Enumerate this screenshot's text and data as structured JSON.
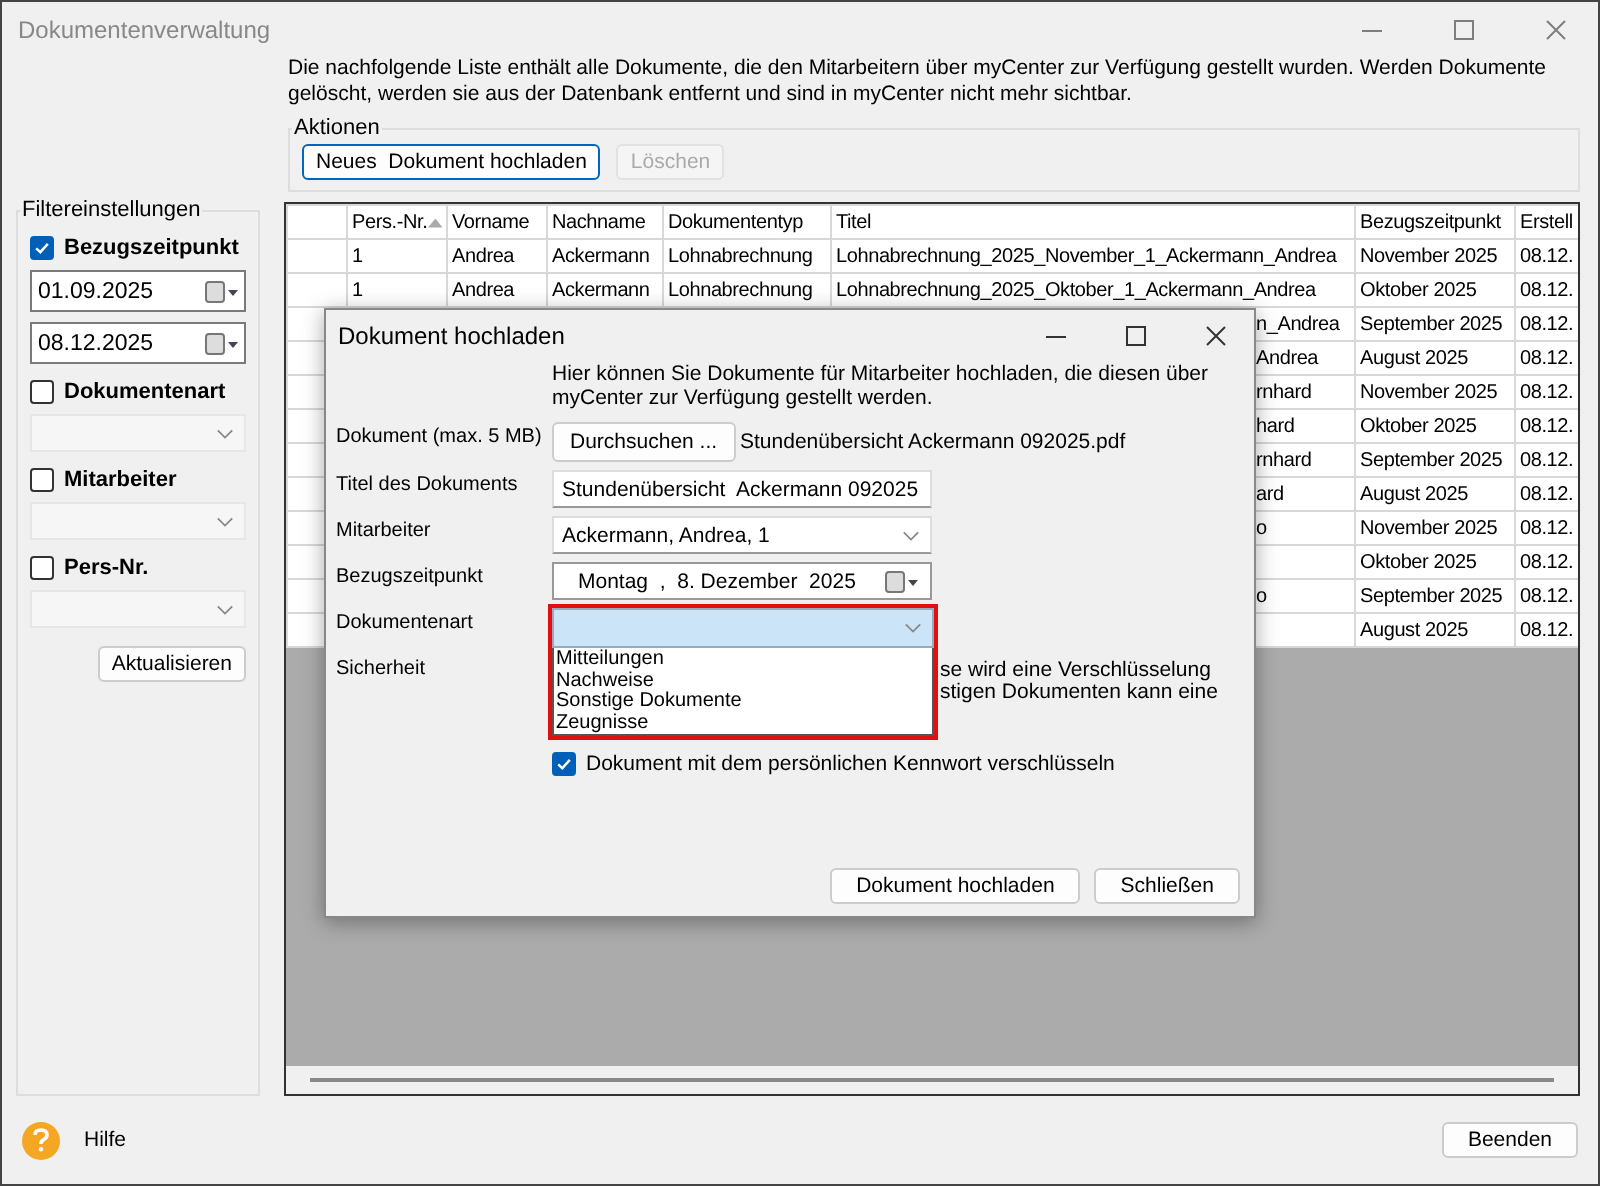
{
  "window": {
    "title": "Dokumentenverwaltung"
  },
  "description": "Die nachfolgende Liste enthält alle Dokumente, die den Mitarbeitern über myCenter zur Verfügung gestellt wurden. Werden Dokumente gelöscht, werden sie aus der Datenbank entfernt und sind in myCenter nicht mehr sichtbar.",
  "actions": {
    "title": "Aktionen",
    "buttons": [
      {
        "label": "Neues  Dokument hochladen",
        "disabled": false,
        "focused": true
      },
      {
        "label": "Löschen",
        "disabled": true,
        "focused": false
      }
    ]
  },
  "filters": {
    "title": "Filtereinstellungen",
    "items": [
      {
        "kind": "dates",
        "label": "Bezugszeitpunkt",
        "checked": true,
        "dates": [
          "01.09.2025",
          "08.12.2025"
        ]
      },
      {
        "kind": "combo",
        "label": "Dokumentenart",
        "checked": false
      },
      {
        "kind": "combo",
        "label": "Mitarbeiter",
        "checked": false
      },
      {
        "kind": "combo",
        "label": "Pers-Nr.",
        "checked": false
      }
    ],
    "button": "Aktualisieren"
  },
  "table": {
    "columns": [
      {
        "label": "Pers.-Nr.",
        "sorted": true
      },
      {
        "label": "Vorname",
        "sorted": false
      },
      {
        "label": "Nachname",
        "sorted": false
      },
      {
        "label": "Dokumententyp",
        "sorted": false
      },
      {
        "label": "Titel",
        "sorted": false
      },
      {
        "label": "Bezugszeitpunkt",
        "sorted": false
      },
      {
        "label": "Erstell",
        "sorted": false
      }
    ],
    "rows": [
      {
        "kind": "full",
        "cells": [
          "1",
          "Andrea",
          "Ackermann",
          "Lohnabrechnung",
          "Lohnabrechnung_2025_November_1_Ackermann_Andrea",
          "November 2025",
          "08.12."
        ]
      },
      {
        "kind": "full",
        "cells": [
          "1",
          "Andrea",
          "Ackermann",
          "Lohnabrechnung",
          "Lohnabrechnung_2025_Oktober_1_Ackermann_Andrea",
          "Oktober 2025",
          "08.12."
        ]
      },
      {
        "kind": "covered",
        "title_fragment": "n_Andrea",
        "period": "September 2025",
        "created": "08.12."
      },
      {
        "kind": "covered",
        "title_fragment": "Andrea",
        "period": "August 2025",
        "created": "08.12."
      },
      {
        "kind": "covered",
        "title_fragment": "rnhard",
        "period": "November 2025",
        "created": "08.12."
      },
      {
        "kind": "covered",
        "title_fragment": "hard",
        "period": "Oktober 2025",
        "created": "08.12."
      },
      {
        "kind": "covered",
        "title_fragment": "rnhard",
        "period": "September 2025",
        "created": "08.12."
      },
      {
        "kind": "covered",
        "title_fragment": "ard",
        "period": "August 2025",
        "created": "08.12."
      },
      {
        "kind": "covered",
        "title_fragment": "o",
        "period": "November 2025",
        "created": "08.12."
      },
      {
        "kind": "covered",
        "period": "Oktober 2025",
        "created": "08.12."
      },
      {
        "kind": "covered",
        "title_fragment": "o",
        "period": "September 2025",
        "created": "08.12."
      },
      {
        "kind": "covered",
        "period": "August 2025",
        "created": "08.12."
      }
    ]
  },
  "footer": {
    "help": "Hilfe",
    "button": "Beenden"
  },
  "dialog": {
    "title": "Dokument hochladen",
    "intro": "Hier können Sie Dokumente für Mitarbeiter hochladen, die diesen über myCenter zur Verfügung gestellt werden.",
    "document": {
      "label": "Dokument (max. 5 MB)",
      "button": "Durchsuchen ...",
      "file": "Stundenübersicht  Ackermann 092025.pdf"
    },
    "title_field": {
      "label": "Titel des Dokuments",
      "value": "Stundenübersicht  Ackermann 092025"
    },
    "employee": {
      "label": "Mitarbeiter",
      "value": "Ackermann, Andrea, 1"
    },
    "period": {
      "label": "Bezugszeitpunkt",
      "value": "Montag  ,  8. Dezember  2025"
    },
    "doc_type": {
      "label": "Dokumentenart",
      "expanded": true,
      "options": [
        "Mitteilungen",
        "Nachweise",
        "Sonstige Dokumente",
        "Zeugnisse"
      ]
    },
    "security": {
      "label": "Sicherheit",
      "lines": [
        "se wird eine Verschlüsselung",
        "stigen Dokumenten kann eine"
      ],
      "checkbox": {
        "label": "Dokument mit dem persönlichen Kennwort verschlüsseln",
        "checked": true
      }
    },
    "buttons": [
      "Dokument hochladen",
      "Schließen"
    ]
  }
}
